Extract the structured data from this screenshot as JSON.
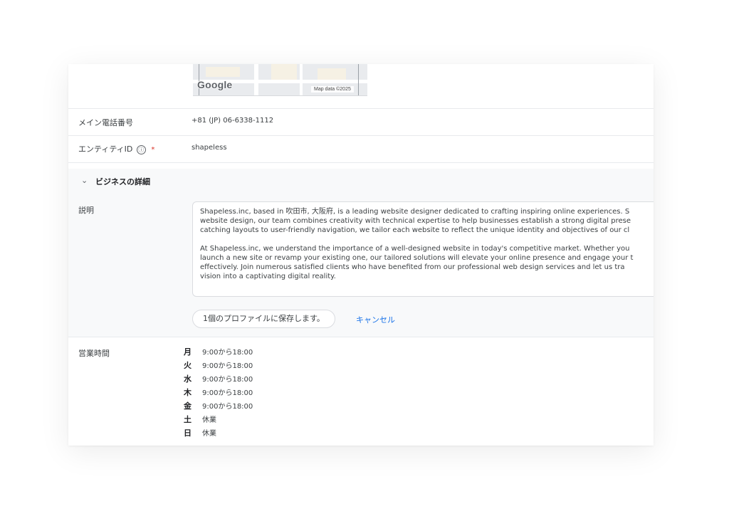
{
  "map": {
    "logo": "Google",
    "attribution": "Map data ©2025"
  },
  "fields": {
    "phone": {
      "label": "メイン電話番号",
      "value": "+81 (JP) 06-6338-1112"
    },
    "entity": {
      "label": "エンティティID",
      "info_glyph": "ⓘ",
      "required_mark": "*",
      "value": "shapeless"
    }
  },
  "section": {
    "chevron": "⌄",
    "title": "ビジネスの詳細"
  },
  "description": {
    "label": "説明",
    "lines": [
      "Shapeless.inc, based in 吹田市, 大阪府, is a leading website designer dedicated to crafting inspiring online experiences. S",
      "website design, our team combines creativity with technical expertise to help businesses establish a strong digital prese",
      "catching layouts to user-friendly navigation, we tailor each website to reflect the unique identity and objectives of our cl",
      "At Shapeless.inc, we understand the importance of a well-designed website in today's competitive market. Whether you",
      "launch a new site or revamp your existing one, our tailored solutions will elevate your online presence and engage your t",
      "effectively. Join numerous satisfied clients who have benefited from our professional web design services and let us tra",
      "vision into a captivating digital reality."
    ],
    "save_label": "1個のプロファイルに保存します。",
    "cancel_label": "キャンセル"
  },
  "hours": {
    "label": "営業時間",
    "days": [
      {
        "day": "月",
        "time": "9:00から18:00"
      },
      {
        "day": "火",
        "time": "9:00から18:00"
      },
      {
        "day": "水",
        "time": "9:00から18:00"
      },
      {
        "day": "木",
        "time": "9:00から18:00"
      },
      {
        "day": "金",
        "time": "9:00から18:00"
      },
      {
        "day": "土",
        "time": "休業"
      },
      {
        "day": "日",
        "time": "休業"
      }
    ]
  },
  "colors": {
    "link": "#1a73e8",
    "required": "#d93025",
    "section_bg": "#f8f9fa"
  }
}
